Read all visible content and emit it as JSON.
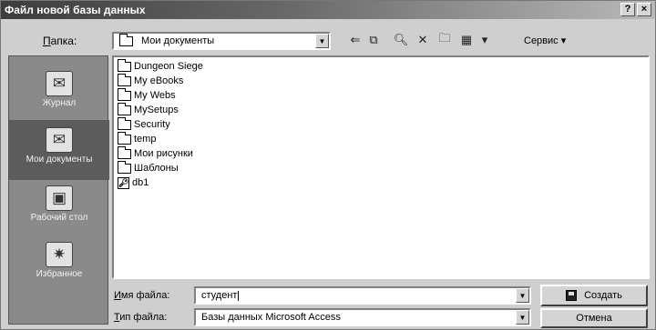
{
  "window": {
    "title": "Файл новой базы данных",
    "help_btn": "?",
    "close_btn": "×"
  },
  "toolbar": {
    "look_in_label_u": "П",
    "look_in_label_rest": "апка:",
    "look_in_value": "Мои документы",
    "tools_label": "Сервис ▾"
  },
  "places": [
    {
      "label": "Журнал",
      "icon": "history-icon"
    },
    {
      "label": "Мои документы",
      "icon": "my-documents-icon"
    },
    {
      "label": "Рабочий стол",
      "icon": "desktop-icon"
    },
    {
      "label": "Избранное",
      "icon": "favorites-icon"
    }
  ],
  "files": [
    {
      "name": "Dungeon Siege",
      "type": "folder"
    },
    {
      "name": "My eBooks",
      "type": "folder"
    },
    {
      "name": "My Webs",
      "type": "folder"
    },
    {
      "name": "MySetups",
      "type": "folder"
    },
    {
      "name": "Security",
      "type": "folder"
    },
    {
      "name": "temp",
      "type": "folder"
    },
    {
      "name": "Мои рисунки",
      "type": "folder"
    },
    {
      "name": "Шаблоны",
      "type": "folder"
    },
    {
      "name": "db1",
      "type": "database"
    }
  ],
  "filename": {
    "label_u": "И",
    "label_rest": "мя файла:",
    "value": "студент"
  },
  "filetype": {
    "label_u": "Т",
    "label_rest": "ип файла:",
    "value": "Базы данных Microsoft Access"
  },
  "buttons": {
    "create": "Создать",
    "cancel": "Отмена"
  }
}
